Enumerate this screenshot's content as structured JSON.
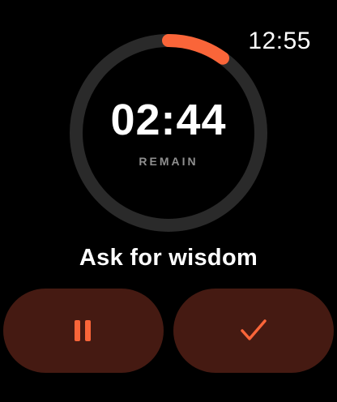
{
  "status_bar": {
    "time": "12:55"
  },
  "timer": {
    "remaining": "02:44",
    "remain_label": "REMAIN",
    "progress_fraction": 0.1,
    "track_color": "#2a2a2a",
    "progress_color": "#fa6539"
  },
  "task": {
    "title": "Ask for wisdom"
  },
  "controls": {
    "pause_icon": "pause-icon",
    "complete_icon": "checkmark-icon",
    "button_color": "#451a12",
    "accent_color": "#fa6539"
  }
}
